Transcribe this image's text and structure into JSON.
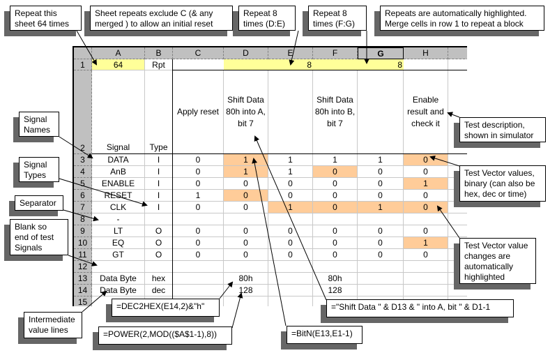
{
  "columns": [
    "A",
    "B",
    "C",
    "D",
    "E",
    "F",
    "G",
    "H"
  ],
  "selected_column": "G",
  "row_numbers": [
    "1",
    "2",
    "3",
    "4",
    "5",
    "6",
    "7",
    "8",
    "9",
    "10",
    "11",
    "12",
    "13",
    "14",
    "15"
  ],
  "row1": {
    "A": "64",
    "B": "Rpt",
    "DE": "8",
    "FG": "8"
  },
  "row2": {
    "A": "Signal",
    "B": "Type",
    "C": "Apply reset",
    "D": "Shift Data 80h into A, bit 7",
    "F": "Shift Data 80h into B, bit 7",
    "H": "Enable result and check it"
  },
  "signals": [
    {
      "name": "DATA",
      "type": "I",
      "C": "0",
      "D": "1",
      "E": "1",
      "F": "1",
      "G": "1",
      "H": "0",
      "hl": [
        "D",
        "H"
      ]
    },
    {
      "name": "AnB",
      "type": "I",
      "C": "0",
      "D": "1",
      "E": "1",
      "F": "0",
      "G": "0",
      "H": "0",
      "hl": [
        "D",
        "F"
      ]
    },
    {
      "name": "ENABLE",
      "type": "I",
      "C": "0",
      "D": "0",
      "E": "0",
      "F": "0",
      "G": "0",
      "H": "1",
      "hl": [
        "H"
      ]
    },
    {
      "name": "RESET",
      "type": "I",
      "C": "1",
      "D": "0",
      "E": "0",
      "F": "0",
      "G": "0",
      "H": "0",
      "hl": [
        "D"
      ]
    },
    {
      "name": "CLK",
      "type": "I",
      "C": "0",
      "D": "0",
      "E": "1",
      "F": "0",
      "G": "1",
      "H": "0",
      "hl": [
        "E",
        "F",
        "G",
        "H"
      ]
    },
    {
      "name": "-",
      "type": "",
      "C": "",
      "D": "",
      "E": "",
      "F": "",
      "G": "",
      "H": "",
      "hl": []
    },
    {
      "name": "LT",
      "type": "O",
      "C": "0",
      "D": "0",
      "E": "0",
      "F": "0",
      "G": "0",
      "H": "0",
      "hl": []
    },
    {
      "name": "EQ",
      "type": "O",
      "C": "0",
      "D": "0",
      "E": "0",
      "F": "0",
      "G": "0",
      "H": "1",
      "hl": [
        "H"
      ]
    },
    {
      "name": "GT",
      "type": "O",
      "C": "0",
      "D": "0",
      "E": "0",
      "F": "0",
      "G": "0",
      "H": "0",
      "hl": []
    },
    {
      "name": "",
      "type": "",
      "C": "",
      "D": "",
      "E": "",
      "F": "",
      "G": "",
      "H": "",
      "hl": []
    },
    {
      "name": "Data Byte",
      "type": "hex",
      "C": "",
      "D": "80h",
      "E": "",
      "F": "80h",
      "G": "",
      "H": "",
      "hl": []
    },
    {
      "name": "Data Byte",
      "type": "dec",
      "C": "",
      "D": "128",
      "E": "",
      "F": "128",
      "G": "",
      "H": "",
      "hl": []
    },
    {
      "name": "",
      "type": "",
      "C": "",
      "D": "",
      "E": "",
      "F": "",
      "G": "",
      "H": "",
      "hl": []
    }
  ],
  "colors": {
    "repeat_highlight": "#ffff99",
    "change_highlight": "#ffcc99",
    "header_gray": "#c0c0c0"
  },
  "callouts": {
    "repeat_sheet": "Repeat this\nsheet 64 times",
    "sheet_repeats": "Sheet repeats exclude C (& any\nmerged ) to allow an initial reset",
    "repeat_de": "Repeat 8\ntimes (D:E)",
    "repeat_fg": "Repeat 8\ntimes (F:G)",
    "auto_highlight": "Repeats are automatically highlighted.\nMerge cells in row 1 to repeat a block",
    "signal_names": "Signal\nNames",
    "signal_types": "Signal\nTypes",
    "separator": "Separator",
    "blank": "Blank so\nend of test\nSignals",
    "test_description": "Test description,\nshown in simulator",
    "test_vector_values": "Test Vector values,\nbinary (can also be\nhex, dec or time)",
    "test_vector_changes": "Test Vector value\nchanges are\nautomatically\nhighlighted",
    "intermediate": "Intermediate\nvalue lines",
    "dec2hex": "=DEC2HEX(E14,2)&\"h\"",
    "power": "=POWER(2,MOD(($A$1-1),8))",
    "bitn": "=BitN(E13,E1-1)",
    "shift_formula": "=\"Shift Data \" & D13 & \" into A, bit \" & D1-1"
  }
}
